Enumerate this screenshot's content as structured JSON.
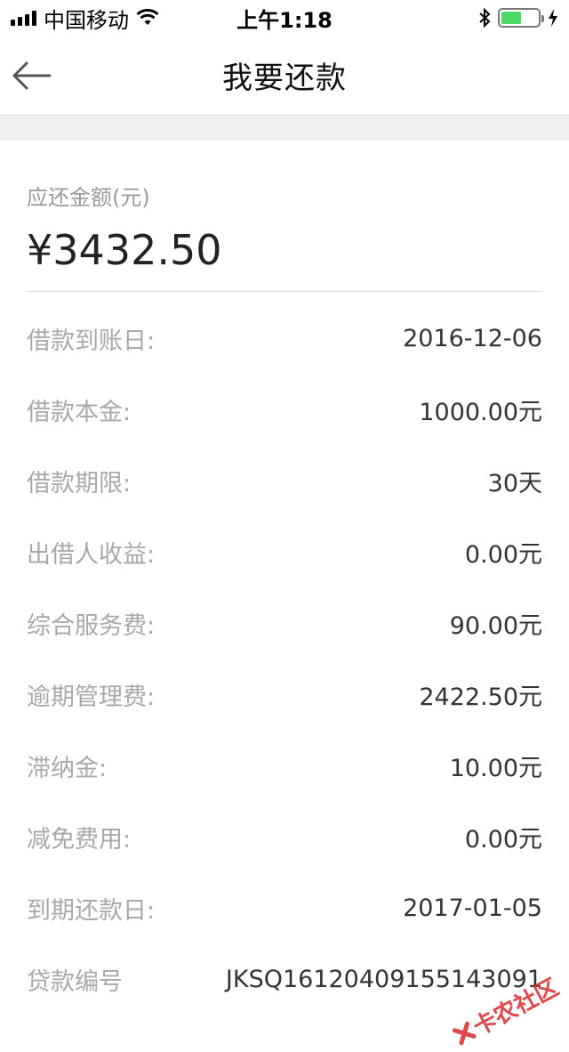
{
  "status_bar": {
    "carrier": "中国移动",
    "time": "上午1:18",
    "battery_color": "#4cd964"
  },
  "nav": {
    "title": "我要还款"
  },
  "amount": {
    "label": "应还金额(元)",
    "value": "¥3432.50"
  },
  "details": [
    {
      "label": "借款到账日:",
      "value": "2016-12-06"
    },
    {
      "label": "借款本金:",
      "value": "1000.00元"
    },
    {
      "label": "借款期限:",
      "value": "30天"
    },
    {
      "label": "出借人收益:",
      "value": "0.00元"
    },
    {
      "label": "综合服务费:",
      "value": "90.00元"
    },
    {
      "label": "逾期管理费:",
      "value": "2422.50元"
    },
    {
      "label": "滞纳金:",
      "value": "10.00元"
    },
    {
      "label": "减免费用:",
      "value": "0.00元"
    },
    {
      "label": "到期还款日:",
      "value": "2017-01-05"
    },
    {
      "label": "贷款编号",
      "value": "JKSQ16120409155143091"
    }
  ],
  "watermark": {
    "text": "卡农社区"
  }
}
